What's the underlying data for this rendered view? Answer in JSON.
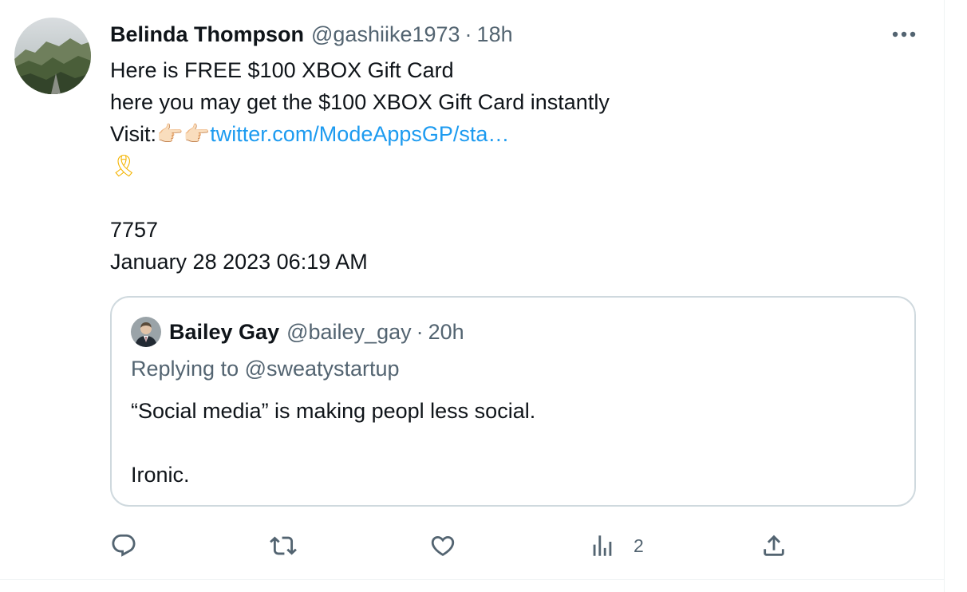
{
  "tweet": {
    "author_name": "Belinda Thompson",
    "author_handle": "@gashiike1973",
    "separator": "·",
    "time": "18h",
    "line1": "Here is FREE $100 XBOX Gift Card",
    "line2": "here you may get the $100 XBOX Gift Card instantly",
    "visit_label": "Visit:",
    "visit_emoji": "👉🏻👉🏻",
    "link_text": "twitter.com/ModeAppsGP/sta…",
    "ribbon_emoji": "🎗",
    "code": "7757",
    "date": "January 28 2023 06:19 AM"
  },
  "quoted": {
    "author_name": "Bailey Gay",
    "author_handle": "@bailey_gay",
    "separator": "·",
    "time": "20h",
    "replying_to": "Replying to @sweatystartup",
    "text_line1": "“Social media” is making peopl less social.",
    "text_line2": "Ironic."
  },
  "actions": {
    "reply_icon": "reply-icon",
    "retweet_icon": "retweet-icon",
    "like_icon": "heart-icon",
    "views_icon": "views-icon",
    "views_count": "2",
    "share_icon": "share-icon"
  },
  "colors": {
    "text": "#0f1419",
    "secondary": "#536471",
    "link": "#1d9bf0",
    "border": "#cfd9de"
  }
}
